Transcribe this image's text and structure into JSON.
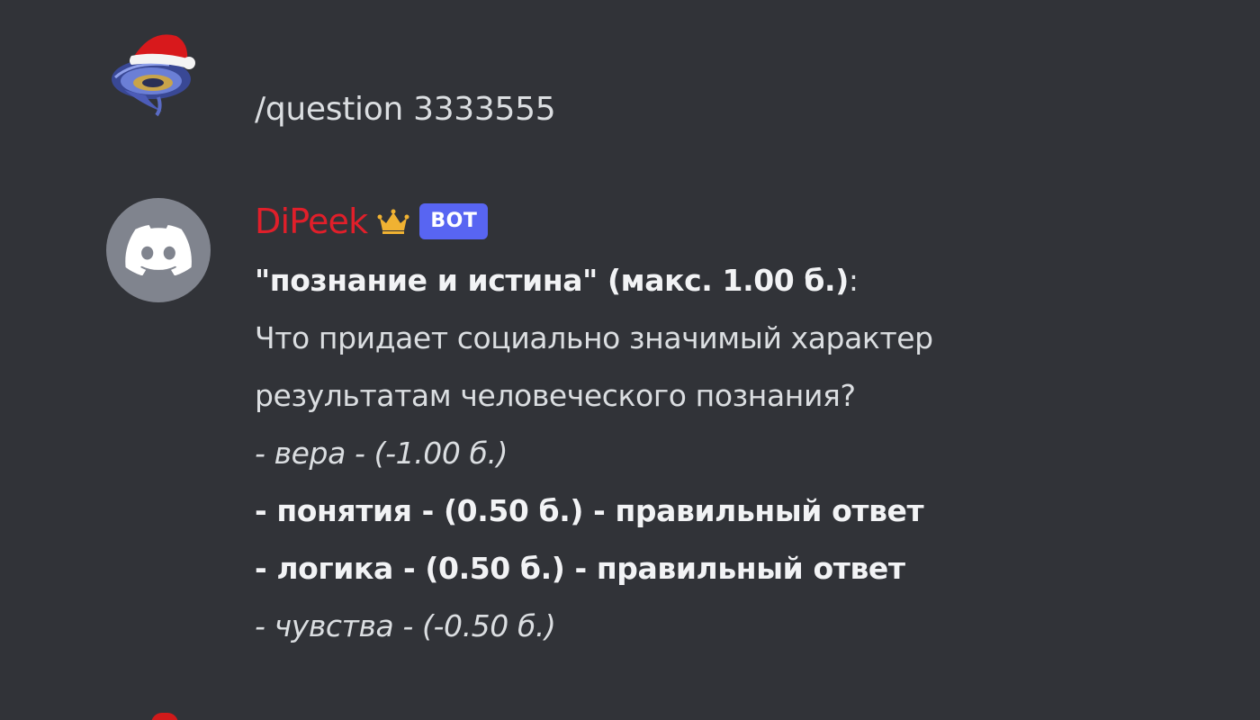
{
  "messages": {
    "command": {
      "text": "/question 3333555"
    },
    "bot": {
      "username": "DiPeek",
      "tag": "BOT",
      "title": "\"познание и истина\" (макс. 1.00 б.)",
      "title_suffix": ":",
      "question_line1": "Что придает социально значимый характер",
      "question_line2": "результатам человеческого познания?",
      "answers": [
        "- вера - (-1.00 б.)",
        "- понятия - (0.50 б.) - правильный ответ",
        "- логика - (0.50 б.) - правильный ответ",
        "- чувства - (-0.50 б.)"
      ]
    }
  },
  "colors": {
    "background": "#313338",
    "username": "#e01f2a",
    "bot_tag": "#5865f2",
    "avatar_bg": "#80848e",
    "crown": "#f0b232"
  }
}
